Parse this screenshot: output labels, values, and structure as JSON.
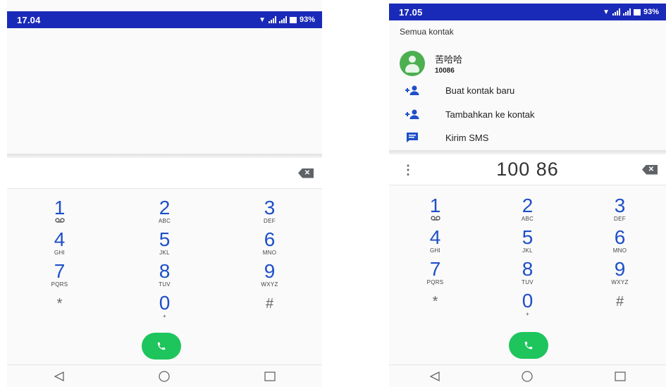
{
  "left_screen": {
    "status": {
      "time": "17.04",
      "battery": "93%"
    },
    "digits": "",
    "keypad": [
      [
        {
          "digit": "1",
          "letters": "voicemail"
        },
        {
          "digit": "2",
          "letters": "ABC"
        },
        {
          "digit": "3",
          "letters": "DEF"
        }
      ],
      [
        {
          "digit": "4",
          "letters": "GHI"
        },
        {
          "digit": "5",
          "letters": "JKL"
        },
        {
          "digit": "6",
          "letters": "MNO"
        }
      ],
      [
        {
          "digit": "7",
          "letters": "PQRS"
        },
        {
          "digit": "8",
          "letters": "TUV"
        },
        {
          "digit": "9",
          "letters": "WXYZ"
        }
      ],
      [
        {
          "digit": "*",
          "letters": ""
        },
        {
          "digit": "0",
          "letters": "+"
        },
        {
          "digit": "#",
          "letters": ""
        }
      ]
    ]
  },
  "right_screen": {
    "status": {
      "time": "17.05",
      "battery": "93%"
    },
    "contacts_header": "Semua kontak",
    "contact": {
      "name": "苦哈哈",
      "number": "10086"
    },
    "actions": [
      {
        "label": "Buat kontak baru",
        "icon": "add-person-icon"
      },
      {
        "label": "Tambahkan ke kontak",
        "icon": "add-person-icon"
      },
      {
        "label": "Kirim SMS",
        "icon": "message-icon"
      }
    ],
    "digits": "100 86",
    "keypad": [
      [
        {
          "digit": "1",
          "letters": "voicemail"
        },
        {
          "digit": "2",
          "letters": "ABC"
        },
        {
          "digit": "3",
          "letters": "DEF"
        }
      ],
      [
        {
          "digit": "4",
          "letters": "GHI"
        },
        {
          "digit": "5",
          "letters": "JKL"
        },
        {
          "digit": "6",
          "letters": "MNO"
        }
      ],
      [
        {
          "digit": "7",
          "letters": "PQRS"
        },
        {
          "digit": "8",
          "letters": "TUV"
        },
        {
          "digit": "9",
          "letters": "WXYZ"
        }
      ],
      [
        {
          "digit": "*",
          "letters": ""
        },
        {
          "digit": "0",
          "letters": "+"
        },
        {
          "digit": "#",
          "letters": ""
        }
      ]
    ]
  },
  "colors": {
    "status_bar": "#1a2ab8",
    "key_digit": "#1e50c8",
    "call_button": "#1ec45c",
    "avatar": "#4caf50"
  }
}
